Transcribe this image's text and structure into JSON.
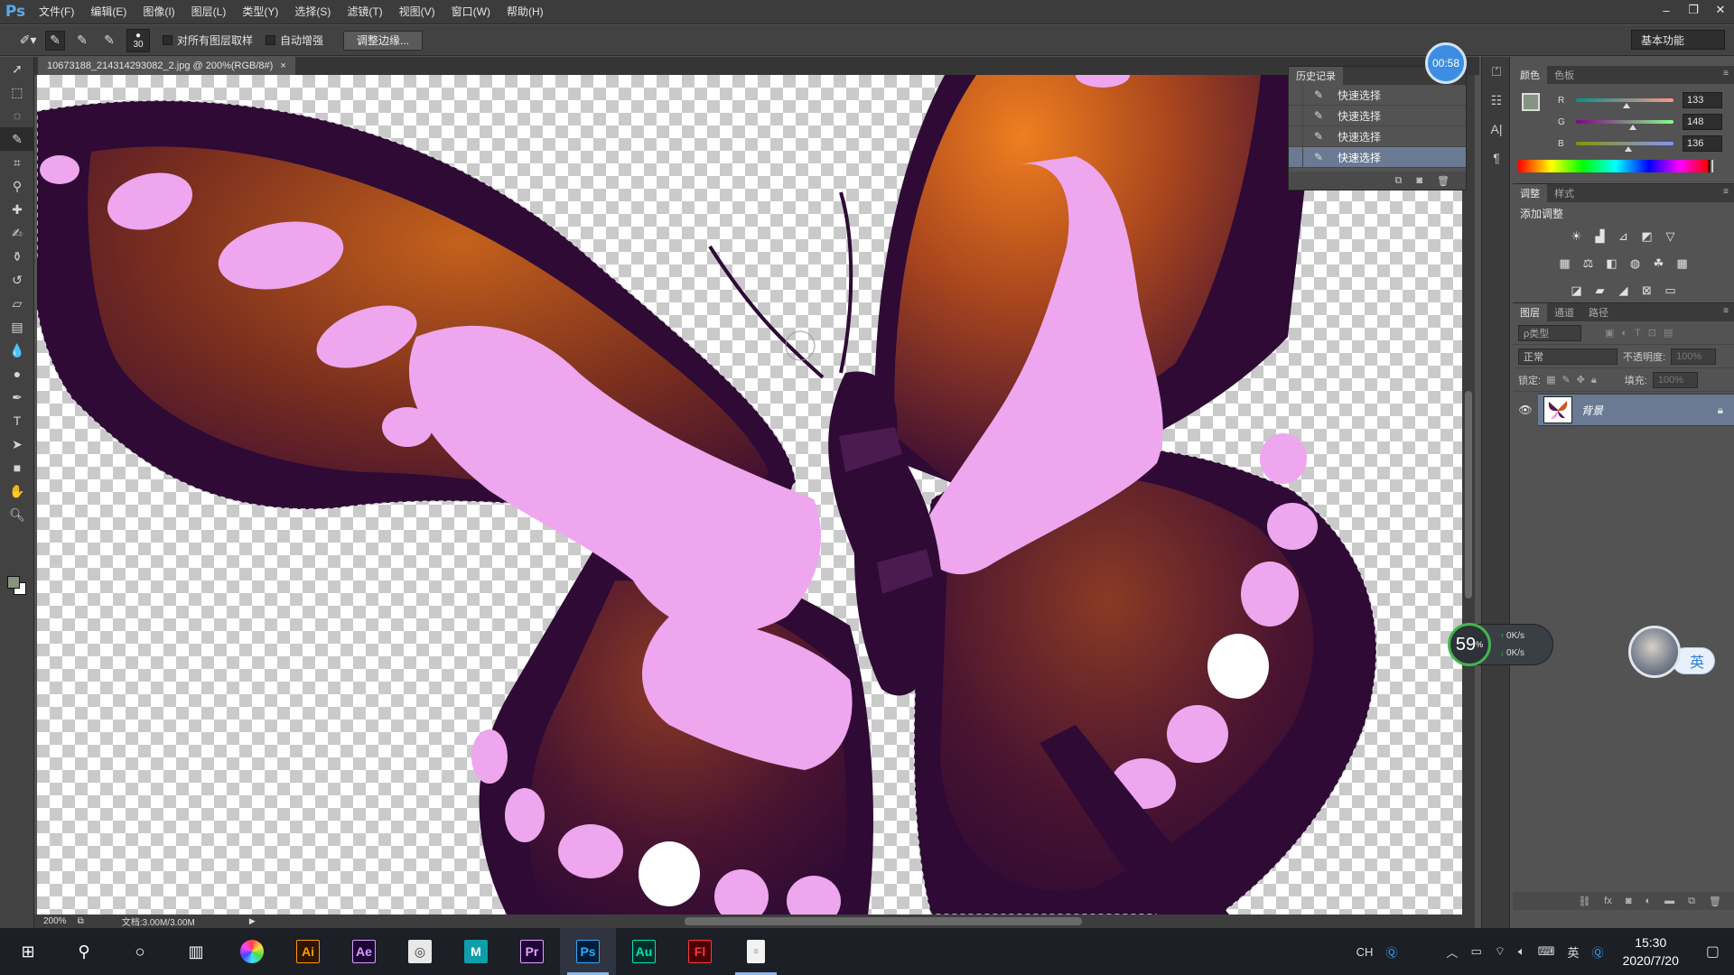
{
  "app": {
    "logo": "Ps",
    "doc_tab": "10673188_214314293082_2.jpg @ 200%(RGB/8#)",
    "doc_close": "×"
  },
  "menu": [
    "文件(F)",
    "编辑(E)",
    "图像(I)",
    "图层(L)",
    "类型(Y)",
    "选择(S)",
    "滤镜(T)",
    "视图(V)",
    "窗口(W)",
    "帮助(H)"
  ],
  "window_controls": [
    "–",
    "❐",
    "✕"
  ],
  "options": {
    "brush_size": "30",
    "sample_all_label": "对所有图层取样",
    "auto_enhance_label": "自动增强",
    "refine_edge_label": "调整边缘...",
    "workspace": "基本功能"
  },
  "timer": "00:58",
  "history": {
    "tab": "历史记录",
    "items": [
      {
        "label": "快速选择",
        "selected": false
      },
      {
        "label": "快速选择",
        "selected": false
      },
      {
        "label": "快速选择",
        "selected": false
      },
      {
        "label": "快速选择",
        "selected": true
      }
    ]
  },
  "color_panel": {
    "tabs": [
      "颜色",
      "色板"
    ],
    "r": 133,
    "g": 148,
    "b": 136,
    "r_label": "R",
    "g_label": "G",
    "b_label": "B",
    "current_color": "#859488"
  },
  "adjust_panel": {
    "tabs": [
      "调整",
      "样式"
    ],
    "add_label": "添加调整"
  },
  "layers_panel": {
    "tabs": [
      "图层",
      "通道",
      "路径"
    ],
    "kind_label": "ρ类型",
    "blend_mode": "正常",
    "opacity_label": "不透明度:",
    "opacity": "100%",
    "lock_label": "锁定:",
    "fill_label": "填充:",
    "fill": "100%",
    "layer_name": "背景"
  },
  "status": {
    "zoom": "200%",
    "doc_info": "文档:3.00M/3.00M"
  },
  "netmon": {
    "percent": "59",
    "percent_unit": "%",
    "up": "0K/s",
    "down": "0K/s"
  },
  "ime": {
    "label": "英"
  },
  "taskbar": {
    "apps": [
      "Ai",
      "Ae",
      "Pr",
      "Ps",
      "Au",
      "Fl"
    ],
    "tray_lang": "CH",
    "tray_ime": "英",
    "time": "15:30",
    "date": "2020/7/20"
  },
  "colors": {
    "butterfly_dark": "#2e0a35",
    "butterfly_orange": "#e07a1e",
    "butterfly_pink": "#eea6ee",
    "ps_blue": "#5aa8e8",
    "selected_row": "#6a7a93"
  }
}
